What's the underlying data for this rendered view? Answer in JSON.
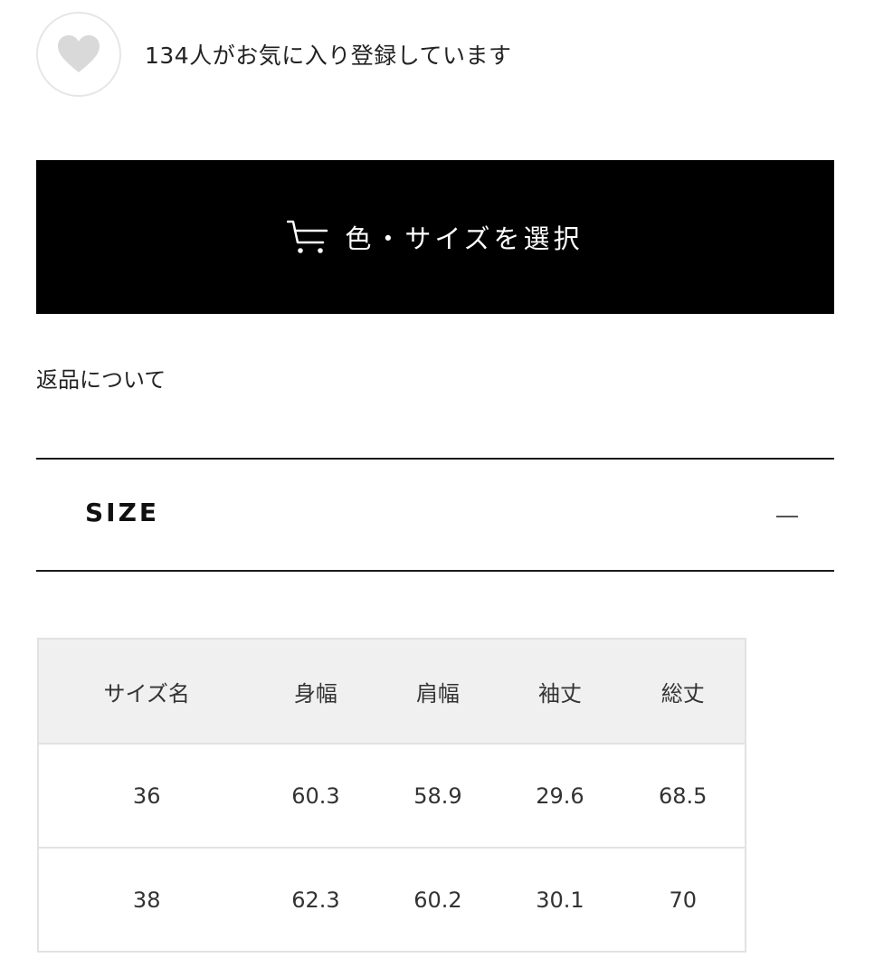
{
  "favorite": {
    "icon": "heart-icon",
    "text": "134人がお気に入り登録しています"
  },
  "select_button": {
    "icon": "cart-icon",
    "label": "色・サイズを選択"
  },
  "returns": {
    "label": "返品について"
  },
  "size_section": {
    "title": "SIZE",
    "toggle_icon": "minus-icon"
  },
  "size_table": {
    "headers": [
      "サイズ名",
      "身幅",
      "肩幅",
      "袖丈",
      "総丈"
    ],
    "rows": [
      [
        "36",
        "60.3",
        "58.9",
        "29.6",
        "68.5"
      ],
      [
        "38",
        "62.3",
        "60.2",
        "30.1",
        "70"
      ]
    ]
  },
  "colors": {
    "button_bg": "#000000",
    "button_text": "#ffffff",
    "heart": "#d9d9d9",
    "table_header_bg": "#f0f0f0"
  }
}
